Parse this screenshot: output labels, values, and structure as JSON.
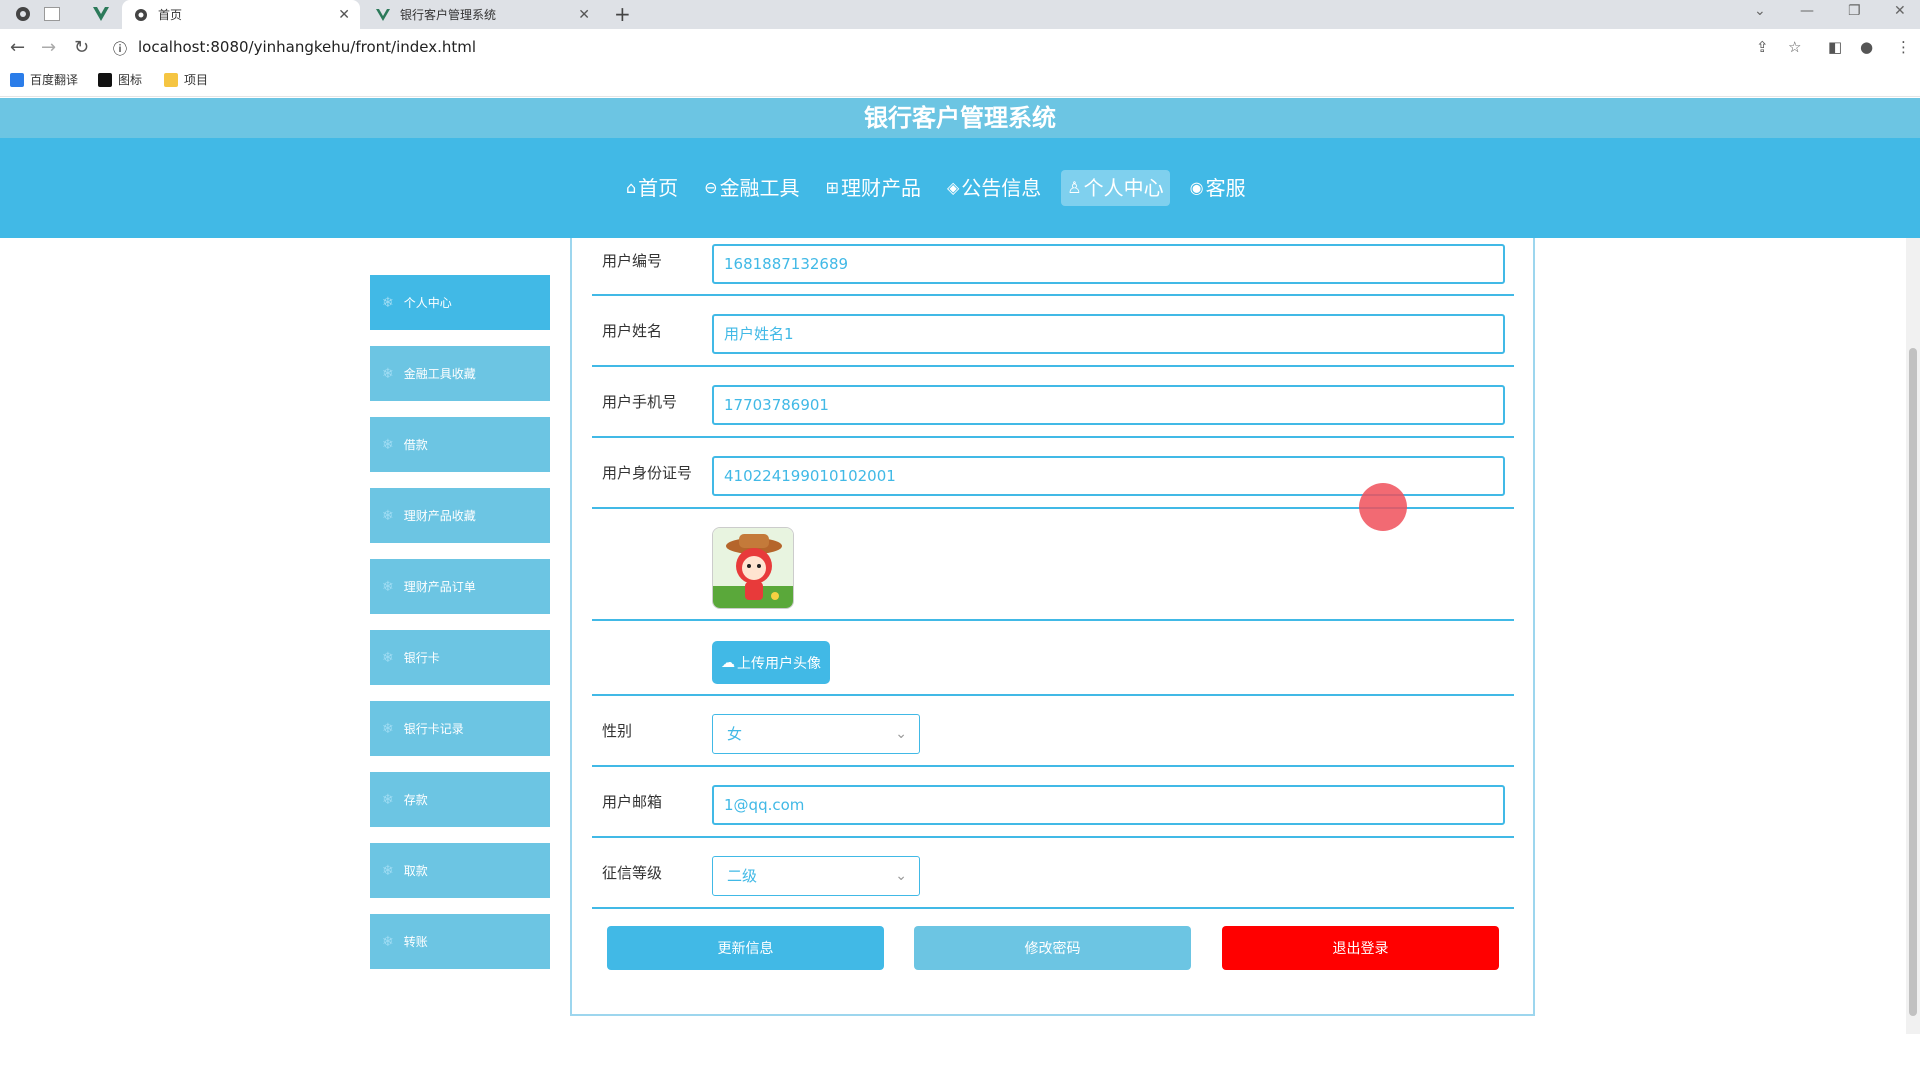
{
  "browser": {
    "tabs": [
      {
        "title": "首页"
      },
      {
        "title": "银行客户管理系统"
      }
    ],
    "url": "localhost:8080/yinhangkehu/front/index.html",
    "bookmarks": [
      "百度翻译",
      "图标",
      "项目"
    ]
  },
  "header": {
    "system_title": "银行客户管理系统",
    "nav": [
      {
        "icon": "home-icon",
        "glyph": "⌂",
        "label": "首页"
      },
      {
        "icon": "tools-icon",
        "glyph": "⊖",
        "label": "金融工具"
      },
      {
        "icon": "product-icon",
        "glyph": "⊞",
        "label": "理财产品"
      },
      {
        "icon": "notice-icon",
        "glyph": "◈",
        "label": "公告信息"
      },
      {
        "icon": "user-icon",
        "glyph": "♙",
        "label": "个人中心"
      },
      {
        "icon": "service-icon",
        "glyph": "◉",
        "label": "客服"
      }
    ]
  },
  "sidebar": {
    "items": [
      {
        "label": "个人中心"
      },
      {
        "label": "金融工具收藏"
      },
      {
        "label": "借款"
      },
      {
        "label": "理财产品收藏"
      },
      {
        "label": "理财产品订单"
      },
      {
        "label": "银行卡"
      },
      {
        "label": "银行卡记录"
      },
      {
        "label": "存款"
      },
      {
        "label": "取款"
      },
      {
        "label": "转账"
      }
    ]
  },
  "form": {
    "user_no": {
      "label": "用户编号",
      "value": "1681887132689"
    },
    "user_name": {
      "label": "用户姓名",
      "value": "用户姓名1"
    },
    "phone": {
      "label": "用户手机号",
      "value": "17703786901"
    },
    "id_card": {
      "label": "用户身份证号",
      "value": "410224199010102001"
    },
    "upload_label": "上传用户头像",
    "gender": {
      "label": "性别",
      "value": "女"
    },
    "email": {
      "label": "用户邮箱",
      "value": "1@qq.com"
    },
    "credit": {
      "label": "征信等级",
      "value": "二级"
    },
    "buttons": {
      "update": "更新信息",
      "change_password": "修改密码",
      "logout": "退出登录"
    }
  },
  "colors": {
    "primary": "#41b9e6",
    "secondary": "#6cc5e3",
    "danger": "#ff0000"
  }
}
